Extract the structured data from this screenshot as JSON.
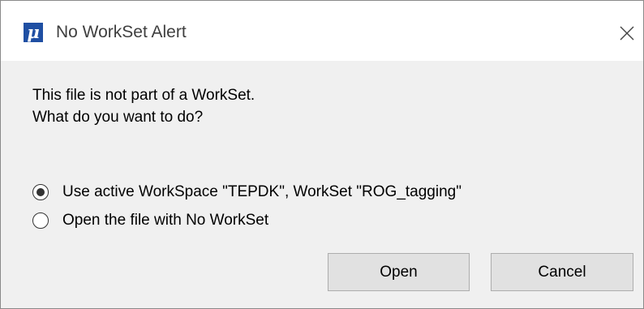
{
  "window": {
    "title": "No WorkSet Alert",
    "app_icon_glyph": "μ",
    "app_icon": "microstation-mu-icon",
    "close_icon": "close-icon"
  },
  "message": {
    "line1": "This file is not part of a WorkSet.",
    "line2": "What do you want to do?"
  },
  "options": [
    {
      "label": "Use active WorkSpace \"TEPDK\", WorkSet \"ROG_tagging\"",
      "selected": true
    },
    {
      "label": "Open the file with No WorkSet",
      "selected": false
    }
  ],
  "buttons": {
    "open_label": "Open",
    "cancel_label": "Cancel"
  },
  "colors": {
    "app_icon_bg": "#1f4fa3",
    "dialog_bg": "#f0f0f0",
    "titlebar_bg": "#ffffff",
    "button_bg": "#e1e1e1"
  }
}
